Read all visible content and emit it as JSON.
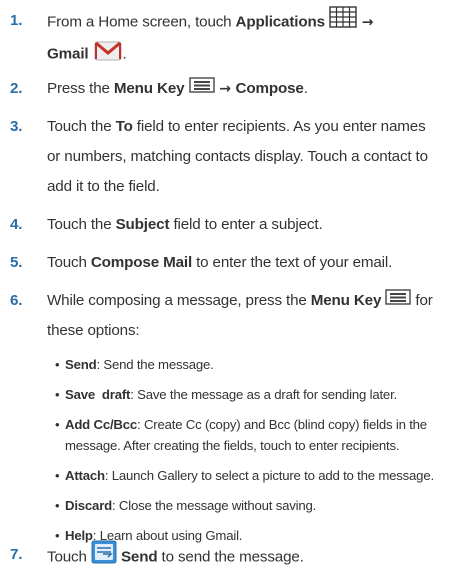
{
  "steps": [
    {
      "num": "1.",
      "pre": "From a Home screen, touch ",
      "b1": "Applications",
      "arrow": " → ",
      "b2": "Gmail",
      "icon1": "applications-grid-icon",
      "icon2": "gmail-envelope-icon"
    },
    {
      "num": "2.",
      "pre": "Press the ",
      "b1": "Menu Key",
      "arrow": " → ",
      "b2": "Compose",
      "post": ".",
      "icon1": "menu-key-icon"
    },
    {
      "num": "3.",
      "pre": "Touch the ",
      "b1": "To",
      "line1": " field to enter recipients. As you enter names",
      "line2": "or numbers, matching contacts display. Touch a contact to",
      "line3": "add it to the field."
    },
    {
      "num": "4.",
      "pre": "Touch the ",
      "b1": "Subject",
      "post": " field to enter a subject."
    },
    {
      "num": "5.",
      "pre": "Touch ",
      "b1": "Compose Mail",
      "post": " to enter the text of your email."
    },
    {
      "num": "6.",
      "pre": "While composing a message, press the ",
      "b1": "Menu Key",
      "post": " for",
      "line2": "these options:",
      "icon1": "menu-key-icon"
    },
    {
      "num": "7.",
      "pre": "Touch ",
      "b1": "Send",
      "post": " to send the message.",
      "icon1": "send-icon"
    }
  ],
  "options": [
    {
      "bullet": "•",
      "label": "Send",
      "desc": ": Send the message."
    },
    {
      "bullet": "•",
      "label": "Save  draft",
      "desc": ": Save the message as a draft for sending later."
    },
    {
      "bullet": "•",
      "label": "Add Cc/Bcc",
      "desc": ": Create Cc (copy) and Bcc (blind copy) fields in the",
      "desc2": "message. After creating the fields, touch to enter recipients."
    },
    {
      "bullet": "•",
      "label": "Attach",
      "desc": ": Launch Gallery to select a picture to add to the message."
    },
    {
      "bullet": "•",
      "label": "Discard",
      "desc": ": Close the message without saving."
    },
    {
      "bullet": "•",
      "label": "Help",
      "desc": ": Learn about using Gmail."
    }
  ]
}
